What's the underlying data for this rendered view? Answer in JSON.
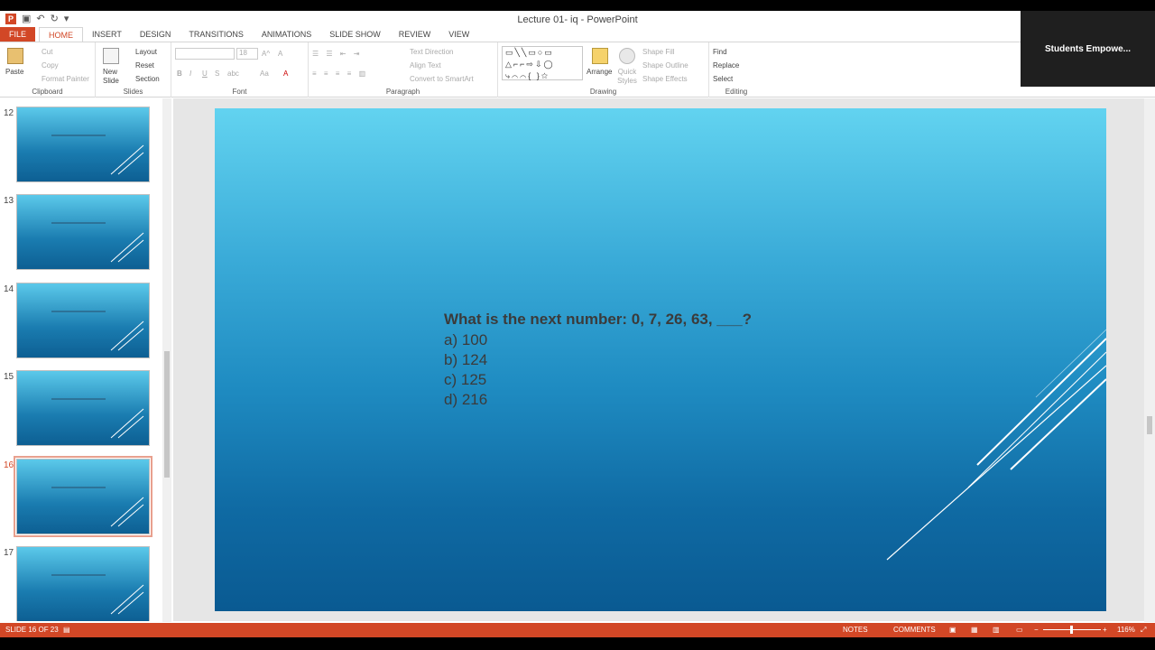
{
  "window": {
    "title": "Lecture 01- iq - PowerPoint"
  },
  "qat": {
    "undo": "↶",
    "redo": "↻",
    "customize": "▾"
  },
  "video": {
    "name": "Students  Empowe..."
  },
  "tabs": [
    {
      "label": "FILE"
    },
    {
      "label": "HOME"
    },
    {
      "label": "INSERT"
    },
    {
      "label": "DESIGN"
    },
    {
      "label": "TRANSITIONS"
    },
    {
      "label": "ANIMATIONS"
    },
    {
      "label": "SLIDE SHOW"
    },
    {
      "label": "REVIEW"
    },
    {
      "label": "VIEW"
    }
  ],
  "ribbon": {
    "clipboard": {
      "label": "Clipboard",
      "paste": "Paste",
      "cut": "Cut",
      "copy": "Copy",
      "format_painter": "Format Painter"
    },
    "slides": {
      "label": "Slides",
      "new_slide": "New Slide",
      "layout": "Layout",
      "reset": "Reset",
      "section": "Section"
    },
    "font": {
      "label": "Font",
      "font_name": "",
      "font_size": "18",
      "bold": "B",
      "italic": "I",
      "underline": "U",
      "strike": "S",
      "spacing": "abc",
      "case": "Aa"
    },
    "paragraph": {
      "label": "Paragraph",
      "text_direction": "Text Direction",
      "align_text": "Align Text",
      "smartart": "Convert to SmartArt"
    },
    "drawing": {
      "label": "Drawing",
      "arrange": "Arrange",
      "quick_styles": "Quick Styles",
      "shape_fill": "Shape Fill",
      "shape_outline": "Shape Outline",
      "shape_effects": "Shape Effects"
    },
    "editing": {
      "label": "Editing",
      "find": "Find",
      "replace": "Replace",
      "select": "Select"
    }
  },
  "thumbnails": [
    {
      "num": "12"
    },
    {
      "num": "13"
    },
    {
      "num": "14"
    },
    {
      "num": "15"
    },
    {
      "num": "16"
    },
    {
      "num": "17"
    }
  ],
  "slide": {
    "question": "What is the next number: 0, 7, 26, 63, ___?",
    "options": [
      "a) 100",
      "b) 124",
      "c) 125",
      "d) 216"
    ]
  },
  "status": {
    "slide_info": "SLIDE 16 OF 23",
    "notes": "NOTES",
    "comments": "COMMENTS",
    "zoom": "116%",
    "zoom_minus": "−",
    "zoom_plus": "+"
  },
  "colors": {
    "accent": "#d24726",
    "slide_top": "#62d3f0",
    "slide_bottom": "#0a5a92"
  }
}
